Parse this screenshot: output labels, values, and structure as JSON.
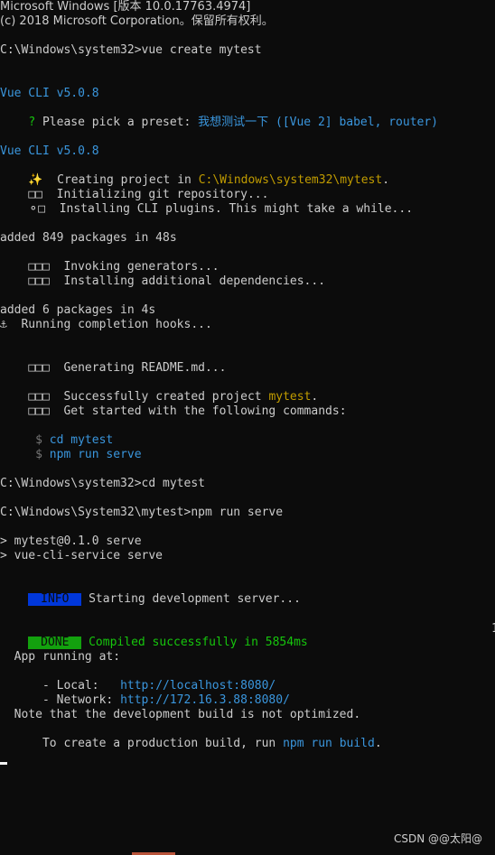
{
  "header": {
    "line1": "Microsoft Windows [版本 10.0.17763.4974]",
    "line2": "(c) 2018 Microsoft Corporation。保留所有权利。"
  },
  "commands": {
    "vue_create": "C:\\Windows\\system32>vue create mytest",
    "cd": "C:\\Windows\\system32>cd mytest",
    "npm_serve": "C:\\Windows\\System32\\mytest>npm run serve"
  },
  "vue_cli": {
    "version_label": "Vue CLI v5.0.8",
    "preset_prompt_q": "?",
    "preset_prompt": " Please pick a preset: ",
    "preset_answer": "我想测试一下",
    "preset_detail": " ([Vue 2] babel, router)",
    "creating_prefix": "✨  Creating project in ",
    "creating_path": "C:\\Windows\\system32\\mytest",
    "creating_suffix": ".",
    "init_git": "  Initializing git repository...",
    "installing_plugins": "  Installing CLI plugins. This might take a while..."
  },
  "install": {
    "added_849": "added 849 packages in 48s",
    "invoking": "  Invoking generators...",
    "installing_deps": "  Installing additional dependencies...",
    "added_6": "added 6 packages in 4s",
    "hooks": "⚓  Running completion hooks...",
    "readme": "  Generating README.md...",
    "success_prefix": "  Successfully created project ",
    "success_project": "mytest",
    "success_suffix": ".",
    "get_started": "  Get started with the following commands:",
    "cmd1_prompt": " $ ",
    "cmd1": "cd mytest",
    "cmd2_prompt": " $ ",
    "cmd2": "npm run serve"
  },
  "serve": {
    "line1": "> mytest@0.1.0 serve",
    "line2": "> vue-cli-service serve",
    "info_badge": " INFO ",
    "info_text": " Starting development server...",
    "done_badge": " DONE ",
    "done_text": " Compiled successfully in 5854ms",
    "app_running": "  App running at:",
    "local_label": "  - Local:   ",
    "local_url": "http://localhost:8080/",
    "network_label": "  - Network: ",
    "network_url": "http://172.16.3.88:8080/",
    "note1": "  Note that the development build is not optimized.",
    "note2_prefix": "  To create a production build, run ",
    "note2_cmd": "npm run build",
    "note2_suffix": ".",
    "right_edge": "1"
  },
  "glyphs": {
    "boxes3": "□□□",
    "boxes2": "□□",
    "spinner_box": "⚬□"
  },
  "watermark": "CSDN @@太阳@"
}
